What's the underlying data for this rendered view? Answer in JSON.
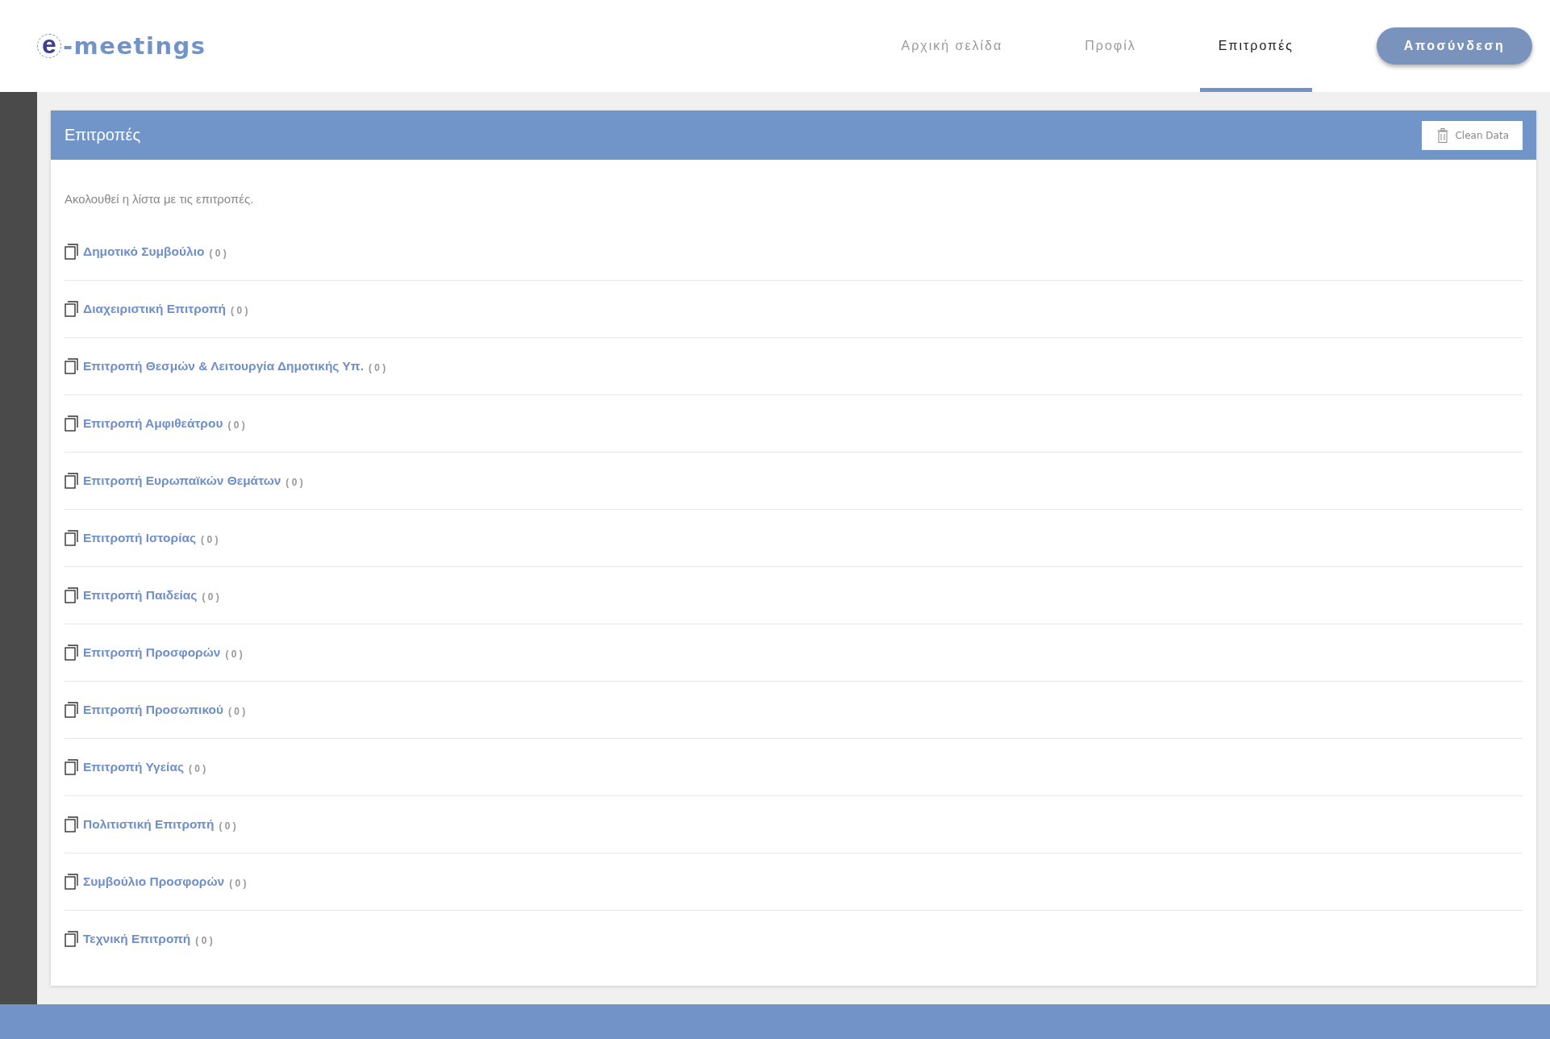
{
  "logo": {
    "letter": "e",
    "text": "-meetings"
  },
  "nav": [
    {
      "label": "Αρχική σελίδα",
      "selected": false
    },
    {
      "label": "Προφίλ",
      "selected": false
    },
    {
      "label": "Επιτροπές",
      "selected": true
    }
  ],
  "logout_button": "Αποσύνδεση",
  "panel": {
    "title": "Επιτροπές",
    "clean_button": "Clean Data",
    "intro": "Ακολουθεί η λίστα με τις επιτροπές.",
    "items": [
      {
        "name": "Δημοτικό Συμβούλιο",
        "count": "( 0 )"
      },
      {
        "name": "Διαχειριστική Επιτροπή",
        "count": "( 0 )"
      },
      {
        "name": "Επιτροπή Θεσμών & Λειτουργία Δημοτικής Υπ.",
        "count": "( 0 )"
      },
      {
        "name": "Επιτροπή Αμφιθεάτρου",
        "count": "( 0 )"
      },
      {
        "name": "Επιτροπή Ευρωπαϊκών Θεμάτων",
        "count": "( 0 )"
      },
      {
        "name": "Επιτροπή Ιστορίας",
        "count": "( 0 )"
      },
      {
        "name": "Επιτροπή Παιδείας",
        "count": "( 0 )"
      },
      {
        "name": "Επιτροπή Προσφορών",
        "count": "( 0 )"
      },
      {
        "name": "Επιτροπή Προσωπικού",
        "count": "( 0 )"
      },
      {
        "name": "Επιτροπή Υγείας",
        "count": "( 0 )"
      },
      {
        "name": "Πολιτιστική Επιτροπή",
        "count": "( 0 )"
      },
      {
        "name": "Συμβούλιο Προσφορών",
        "count": "( 0 )"
      },
      {
        "name": "Τεχνική Επιτροπή",
        "count": "( 0 )"
      }
    ]
  }
}
